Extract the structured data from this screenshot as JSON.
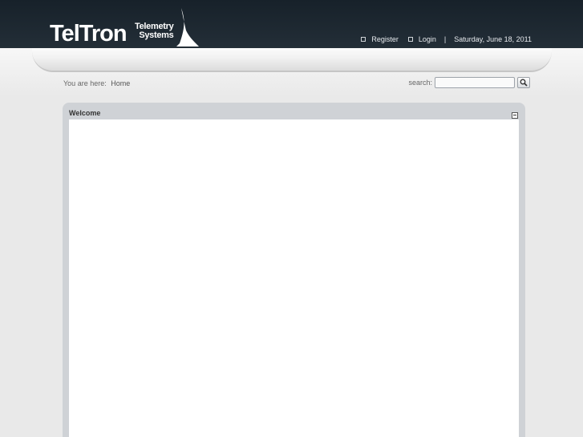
{
  "header": {
    "logo": {
      "main": "TelTron",
      "sub_line1": "Telemetry",
      "sub_line2": "Systems"
    },
    "links": {
      "register": "Register",
      "login": "Login",
      "separator": "|",
      "date": "Saturday, June 18, 2011"
    }
  },
  "breadcrumb": {
    "prefix": "You are here:",
    "current": "Home"
  },
  "search": {
    "label": "search:",
    "value": "",
    "button_icon": "magnifier-icon"
  },
  "panel": {
    "title": "Welcome",
    "collapse_icon": "minimize-icon"
  },
  "colors": {
    "header_bg": "#1d2730",
    "page_bg": "#e9e9e9",
    "panel_frame": "#cfd2d6",
    "panel_body": "#ffffff"
  }
}
